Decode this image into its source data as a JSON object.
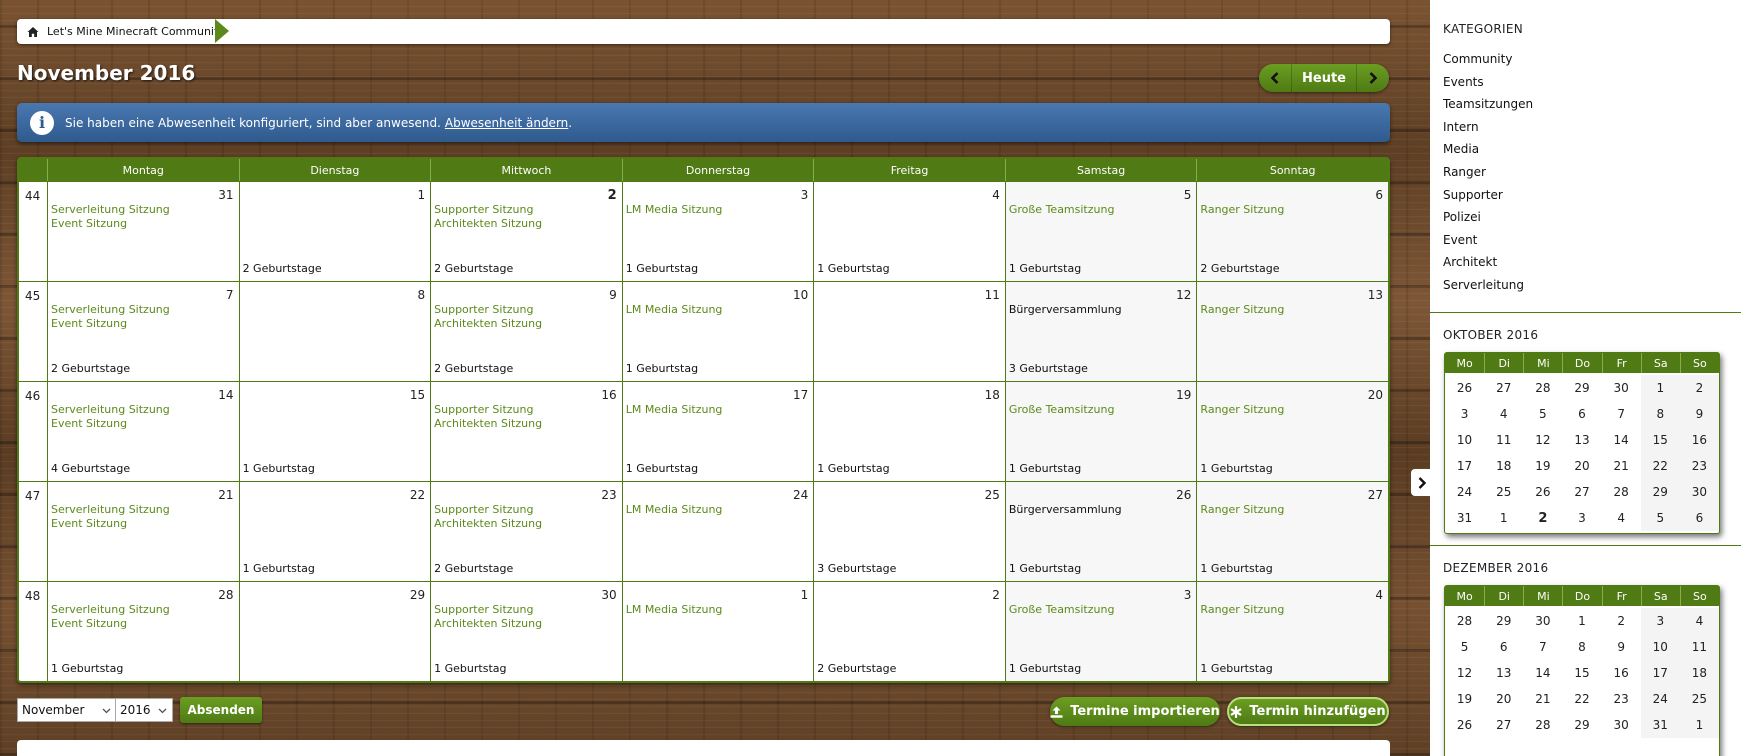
{
  "breadcrumb": {
    "label": "Let's Mine Minecraft Community"
  },
  "page": {
    "title": "November 2016"
  },
  "nav": {
    "today_label": "Heute"
  },
  "info": {
    "text": "Sie haben eine Abwesenheit konfiguriert, sind aber anwesend.",
    "link": "Abwesenheit ändern",
    "suffix": "."
  },
  "calendar": {
    "weekdays": [
      "Montag",
      "Dienstag",
      "Mittwoch",
      "Donnerstag",
      "Freitag",
      "Samstag",
      "Sonntag"
    ],
    "weeks": [
      {
        "number": "44",
        "days": [
          {
            "day": "31",
            "events": [
              "Serverleitung Sitzung",
              "Event Sitzung"
            ],
            "birthdays": ""
          },
          {
            "day": "1",
            "events": [],
            "birthdays": "2 Geburtstage"
          },
          {
            "day": "2",
            "today": true,
            "events": [
              "Supporter Sitzung",
              "Architekten Sitzung"
            ],
            "birthdays": "2 Geburtstage"
          },
          {
            "day": "3",
            "events": [
              "LM Media Sitzung"
            ],
            "birthdays": "1 Geburtstag"
          },
          {
            "day": "4",
            "events": [],
            "birthdays": "1 Geburtstag"
          },
          {
            "day": "5",
            "events": [
              "Große Teamsitzung"
            ],
            "birthdays": "1 Geburtstag"
          },
          {
            "day": "6",
            "events": [
              "Ranger Sitzung"
            ],
            "birthdays": "2 Geburtstage"
          }
        ]
      },
      {
        "number": "45",
        "days": [
          {
            "day": "7",
            "events": [
              "Serverleitung Sitzung",
              "Event Sitzung"
            ],
            "birthdays": "2 Geburtstage"
          },
          {
            "day": "8",
            "events": [],
            "birthdays": ""
          },
          {
            "day": "9",
            "events": [
              "Supporter Sitzung",
              "Architekten Sitzung"
            ],
            "birthdays": "2 Geburtstage"
          },
          {
            "day": "10",
            "events": [
              "LM Media Sitzung"
            ],
            "birthdays": "1 Geburtstag"
          },
          {
            "day": "11",
            "events": [],
            "birthdays": ""
          },
          {
            "day": "12",
            "events_black": [
              "Bürgerversammlung"
            ],
            "events": [],
            "birthdays": "3 Geburtstage"
          },
          {
            "day": "13",
            "events": [
              "Ranger Sitzung"
            ],
            "birthdays": ""
          }
        ]
      },
      {
        "number": "46",
        "days": [
          {
            "day": "14",
            "events": [
              "Serverleitung Sitzung",
              "Event Sitzung"
            ],
            "birthdays": "4 Geburtstage"
          },
          {
            "day": "15",
            "events": [],
            "birthdays": "1 Geburtstag"
          },
          {
            "day": "16",
            "events": [
              "Supporter Sitzung",
              "Architekten Sitzung"
            ],
            "birthdays": ""
          },
          {
            "day": "17",
            "events": [
              "LM Media Sitzung"
            ],
            "birthdays": "1 Geburtstag"
          },
          {
            "day": "18",
            "events": [],
            "birthdays": "1 Geburtstag"
          },
          {
            "day": "19",
            "events": [
              "Große Teamsitzung"
            ],
            "birthdays": "1 Geburtstag"
          },
          {
            "day": "20",
            "events": [
              "Ranger Sitzung"
            ],
            "birthdays": "1 Geburtstag"
          }
        ]
      },
      {
        "number": "47",
        "days": [
          {
            "day": "21",
            "events": [
              "Serverleitung Sitzung",
              "Event Sitzung"
            ],
            "birthdays": ""
          },
          {
            "day": "22",
            "events": [],
            "birthdays": "1 Geburtstag"
          },
          {
            "day": "23",
            "events": [
              "Supporter Sitzung",
              "Architekten Sitzung"
            ],
            "birthdays": "2 Geburtstage"
          },
          {
            "day": "24",
            "events": [
              "LM Media Sitzung"
            ],
            "birthdays": ""
          },
          {
            "day": "25",
            "events": [],
            "birthdays": "3 Geburtstage"
          },
          {
            "day": "26",
            "events_black": [
              "Bürgerversammlung"
            ],
            "events": [],
            "birthdays": "1 Geburtstag"
          },
          {
            "day": "27",
            "events": [
              "Ranger Sitzung"
            ],
            "birthdays": "1 Geburtstag"
          }
        ]
      },
      {
        "number": "48",
        "days": [
          {
            "day": "28",
            "events": [
              "Serverleitung Sitzung",
              "Event Sitzung"
            ],
            "birthdays": "1 Geburtstag"
          },
          {
            "day": "29",
            "events": [],
            "birthdays": ""
          },
          {
            "day": "30",
            "events": [
              "Supporter Sitzung",
              "Architekten Sitzung"
            ],
            "birthdays": "1 Geburtstag"
          },
          {
            "day": "1",
            "events": [
              "LM Media Sitzung"
            ],
            "birthdays": ""
          },
          {
            "day": "2",
            "events": [],
            "birthdays": "2 Geburtstage"
          },
          {
            "day": "3",
            "events": [
              "Große Teamsitzung"
            ],
            "birthdays": "1 Geburtstag"
          },
          {
            "day": "4",
            "events": [
              "Ranger Sitzung"
            ],
            "birthdays": "1 Geburtstag"
          }
        ]
      }
    ]
  },
  "controls": {
    "month_value": "November",
    "year_value": "2016",
    "submit_label": "Absenden",
    "import_label": "Termine importieren",
    "add_label": "Termin hinzufügen"
  },
  "sidebar": {
    "categories_title": "KATEGORIEN",
    "categories": [
      "Community",
      "Events",
      "Teamsitzungen",
      "Intern",
      "Media",
      "Ranger",
      "Supporter",
      "Polizei",
      "Event",
      "Architekt",
      "Serverleitung"
    ],
    "mini_weekdays": [
      "Mo",
      "Di",
      "Mi",
      "Do",
      "Fr",
      "Sa",
      "So"
    ],
    "october": {
      "title": "OKTOBER 2016",
      "days": [
        "26",
        "27",
        "28",
        "29",
        "30",
        "1",
        "2",
        "3",
        "4",
        "5",
        "6",
        "7",
        "8",
        "9",
        "10",
        "11",
        "12",
        "13",
        "14",
        "15",
        "16",
        "17",
        "18",
        "19",
        "20",
        "21",
        "22",
        "23",
        "24",
        "25",
        "26",
        "27",
        "28",
        "29",
        "30",
        "31",
        "1",
        "2",
        "3",
        "4",
        "5",
        "6"
      ]
    },
    "december": {
      "title": "DEZEMBER 2016",
      "days": [
        "28",
        "29",
        "30",
        "1",
        "2",
        "3",
        "4",
        "5",
        "6",
        "7",
        "8",
        "9",
        "10",
        "11",
        "12",
        "13",
        "14",
        "15",
        "16",
        "17",
        "18",
        "19",
        "20",
        "21",
        "22",
        "23",
        "24",
        "25",
        "26",
        "27",
        "28",
        "29",
        "30",
        "31",
        "1"
      ]
    }
  },
  "colors": {
    "accent": "#4f7a14",
    "event_text": "#5c8a1a",
    "info_bg": "#3a68a0"
  }
}
